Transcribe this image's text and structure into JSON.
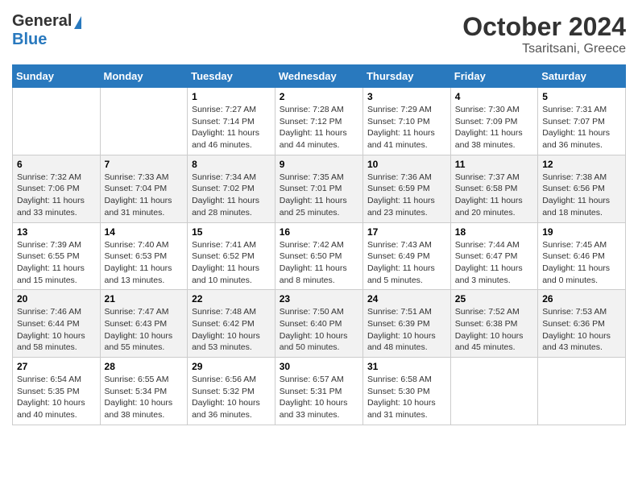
{
  "header": {
    "logo_general": "General",
    "logo_blue": "Blue",
    "month_title": "October 2024",
    "location": "Tsaritsani, Greece"
  },
  "weekdays": [
    "Sunday",
    "Monday",
    "Tuesday",
    "Wednesday",
    "Thursday",
    "Friday",
    "Saturday"
  ],
  "weeks": [
    [
      {
        "day": "",
        "sunrise": "",
        "sunset": "",
        "daylight": ""
      },
      {
        "day": "",
        "sunrise": "",
        "sunset": "",
        "daylight": ""
      },
      {
        "day": "1",
        "sunrise": "Sunrise: 7:27 AM",
        "sunset": "Sunset: 7:14 PM",
        "daylight": "Daylight: 11 hours and 46 minutes."
      },
      {
        "day": "2",
        "sunrise": "Sunrise: 7:28 AM",
        "sunset": "Sunset: 7:12 PM",
        "daylight": "Daylight: 11 hours and 44 minutes."
      },
      {
        "day": "3",
        "sunrise": "Sunrise: 7:29 AM",
        "sunset": "Sunset: 7:10 PM",
        "daylight": "Daylight: 11 hours and 41 minutes."
      },
      {
        "day": "4",
        "sunrise": "Sunrise: 7:30 AM",
        "sunset": "Sunset: 7:09 PM",
        "daylight": "Daylight: 11 hours and 38 minutes."
      },
      {
        "day": "5",
        "sunrise": "Sunrise: 7:31 AM",
        "sunset": "Sunset: 7:07 PM",
        "daylight": "Daylight: 11 hours and 36 minutes."
      }
    ],
    [
      {
        "day": "6",
        "sunrise": "Sunrise: 7:32 AM",
        "sunset": "Sunset: 7:06 PM",
        "daylight": "Daylight: 11 hours and 33 minutes."
      },
      {
        "day": "7",
        "sunrise": "Sunrise: 7:33 AM",
        "sunset": "Sunset: 7:04 PM",
        "daylight": "Daylight: 11 hours and 31 minutes."
      },
      {
        "day": "8",
        "sunrise": "Sunrise: 7:34 AM",
        "sunset": "Sunset: 7:02 PM",
        "daylight": "Daylight: 11 hours and 28 minutes."
      },
      {
        "day": "9",
        "sunrise": "Sunrise: 7:35 AM",
        "sunset": "Sunset: 7:01 PM",
        "daylight": "Daylight: 11 hours and 25 minutes."
      },
      {
        "day": "10",
        "sunrise": "Sunrise: 7:36 AM",
        "sunset": "Sunset: 6:59 PM",
        "daylight": "Daylight: 11 hours and 23 minutes."
      },
      {
        "day": "11",
        "sunrise": "Sunrise: 7:37 AM",
        "sunset": "Sunset: 6:58 PM",
        "daylight": "Daylight: 11 hours and 20 minutes."
      },
      {
        "day": "12",
        "sunrise": "Sunrise: 7:38 AM",
        "sunset": "Sunset: 6:56 PM",
        "daylight": "Daylight: 11 hours and 18 minutes."
      }
    ],
    [
      {
        "day": "13",
        "sunrise": "Sunrise: 7:39 AM",
        "sunset": "Sunset: 6:55 PM",
        "daylight": "Daylight: 11 hours and 15 minutes."
      },
      {
        "day": "14",
        "sunrise": "Sunrise: 7:40 AM",
        "sunset": "Sunset: 6:53 PM",
        "daylight": "Daylight: 11 hours and 13 minutes."
      },
      {
        "day": "15",
        "sunrise": "Sunrise: 7:41 AM",
        "sunset": "Sunset: 6:52 PM",
        "daylight": "Daylight: 11 hours and 10 minutes."
      },
      {
        "day": "16",
        "sunrise": "Sunrise: 7:42 AM",
        "sunset": "Sunset: 6:50 PM",
        "daylight": "Daylight: 11 hours and 8 minutes."
      },
      {
        "day": "17",
        "sunrise": "Sunrise: 7:43 AM",
        "sunset": "Sunset: 6:49 PM",
        "daylight": "Daylight: 11 hours and 5 minutes."
      },
      {
        "day": "18",
        "sunrise": "Sunrise: 7:44 AM",
        "sunset": "Sunset: 6:47 PM",
        "daylight": "Daylight: 11 hours and 3 minutes."
      },
      {
        "day": "19",
        "sunrise": "Sunrise: 7:45 AM",
        "sunset": "Sunset: 6:46 PM",
        "daylight": "Daylight: 11 hours and 0 minutes."
      }
    ],
    [
      {
        "day": "20",
        "sunrise": "Sunrise: 7:46 AM",
        "sunset": "Sunset: 6:44 PM",
        "daylight": "Daylight: 10 hours and 58 minutes."
      },
      {
        "day": "21",
        "sunrise": "Sunrise: 7:47 AM",
        "sunset": "Sunset: 6:43 PM",
        "daylight": "Daylight: 10 hours and 55 minutes."
      },
      {
        "day": "22",
        "sunrise": "Sunrise: 7:48 AM",
        "sunset": "Sunset: 6:42 PM",
        "daylight": "Daylight: 10 hours and 53 minutes."
      },
      {
        "day": "23",
        "sunrise": "Sunrise: 7:50 AM",
        "sunset": "Sunset: 6:40 PM",
        "daylight": "Daylight: 10 hours and 50 minutes."
      },
      {
        "day": "24",
        "sunrise": "Sunrise: 7:51 AM",
        "sunset": "Sunset: 6:39 PM",
        "daylight": "Daylight: 10 hours and 48 minutes."
      },
      {
        "day": "25",
        "sunrise": "Sunrise: 7:52 AM",
        "sunset": "Sunset: 6:38 PM",
        "daylight": "Daylight: 10 hours and 45 minutes."
      },
      {
        "day": "26",
        "sunrise": "Sunrise: 7:53 AM",
        "sunset": "Sunset: 6:36 PM",
        "daylight": "Daylight: 10 hours and 43 minutes."
      }
    ],
    [
      {
        "day": "27",
        "sunrise": "Sunrise: 6:54 AM",
        "sunset": "Sunset: 5:35 PM",
        "daylight": "Daylight: 10 hours and 40 minutes."
      },
      {
        "day": "28",
        "sunrise": "Sunrise: 6:55 AM",
        "sunset": "Sunset: 5:34 PM",
        "daylight": "Daylight: 10 hours and 38 minutes."
      },
      {
        "day": "29",
        "sunrise": "Sunrise: 6:56 AM",
        "sunset": "Sunset: 5:32 PM",
        "daylight": "Daylight: 10 hours and 36 minutes."
      },
      {
        "day": "30",
        "sunrise": "Sunrise: 6:57 AM",
        "sunset": "Sunset: 5:31 PM",
        "daylight": "Daylight: 10 hours and 33 minutes."
      },
      {
        "day": "31",
        "sunrise": "Sunrise: 6:58 AM",
        "sunset": "Sunset: 5:30 PM",
        "daylight": "Daylight: 10 hours and 31 minutes."
      },
      {
        "day": "",
        "sunrise": "",
        "sunset": "",
        "daylight": ""
      },
      {
        "day": "",
        "sunrise": "",
        "sunset": "",
        "daylight": ""
      }
    ]
  ]
}
